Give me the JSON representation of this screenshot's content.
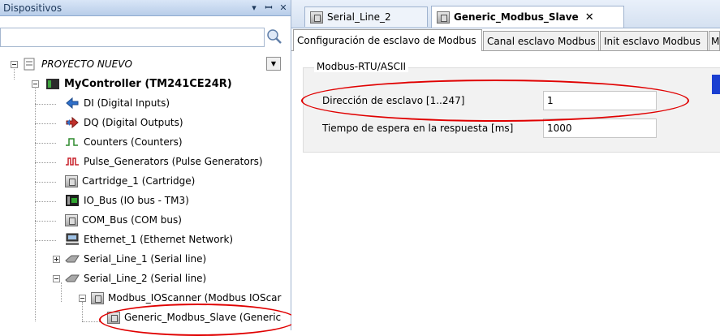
{
  "left_panel": {
    "title": "Dispositivos",
    "pin_glyph": "▾ ⊥",
    "close_glyph": "✕",
    "search": {
      "value": "",
      "placeholder": ""
    },
    "tree": [
      {
        "label": "PROYECTO NUEVO",
        "icon": "project-icon"
      },
      {
        "label": "MyController (TM241CE24R)",
        "icon": "controller-icon"
      },
      {
        "label": "DI (Digital Inputs)",
        "icon": "digital-inputs-icon"
      },
      {
        "label": "DQ (Digital Outputs)",
        "icon": "digital-outputs-icon"
      },
      {
        "label": "Counters (Counters)",
        "icon": "counters-icon"
      },
      {
        "label": "Pulse_Generators (Pulse Generators)",
        "icon": "pulse-generators-icon"
      },
      {
        "label": "Cartridge_1 (Cartridge)",
        "icon": "module-icon"
      },
      {
        "label": "IO_Bus (IO bus - TM3)",
        "icon": "io-bus-icon"
      },
      {
        "label": "COM_Bus (COM bus)",
        "icon": "module-icon"
      },
      {
        "label": "Ethernet_1 (Ethernet Network)",
        "icon": "ethernet-icon"
      },
      {
        "label": "Serial_Line_1 (Serial line)",
        "icon": "serial-line-icon"
      },
      {
        "label": "Serial_Line_2 (Serial line)",
        "icon": "serial-line-icon"
      },
      {
        "label": "Modbus_IOScanner (Modbus IOScar",
        "icon": "module-icon"
      },
      {
        "label": "Generic_Modbus_Slave (Generic",
        "icon": "module-icon"
      }
    ]
  },
  "editor": {
    "doc_tabs": [
      {
        "label": "Serial_Line_2",
        "active": false
      },
      {
        "label": "Generic_Modbus_Slave",
        "active": true,
        "close": "✕"
      }
    ],
    "sub_tabs": [
      {
        "label": "Configuración de esclavo de Modbus",
        "active": true
      },
      {
        "label": "Canal esclavo Modbus",
        "active": false
      },
      {
        "label": "Init esclavo Modbus",
        "active": false
      },
      {
        "label": "M",
        "active": false
      }
    ],
    "group_title": "Modbus-RTU/ASCII",
    "fields": [
      {
        "label": "Dirección de esclavo [1..247]",
        "value": "1"
      },
      {
        "label": "Tiempo de espera en la respuesta [ms]",
        "value": "1000"
      }
    ]
  },
  "colors": {
    "highlight_circle": "#e00000",
    "accent_blue": "#1a3fd1"
  }
}
